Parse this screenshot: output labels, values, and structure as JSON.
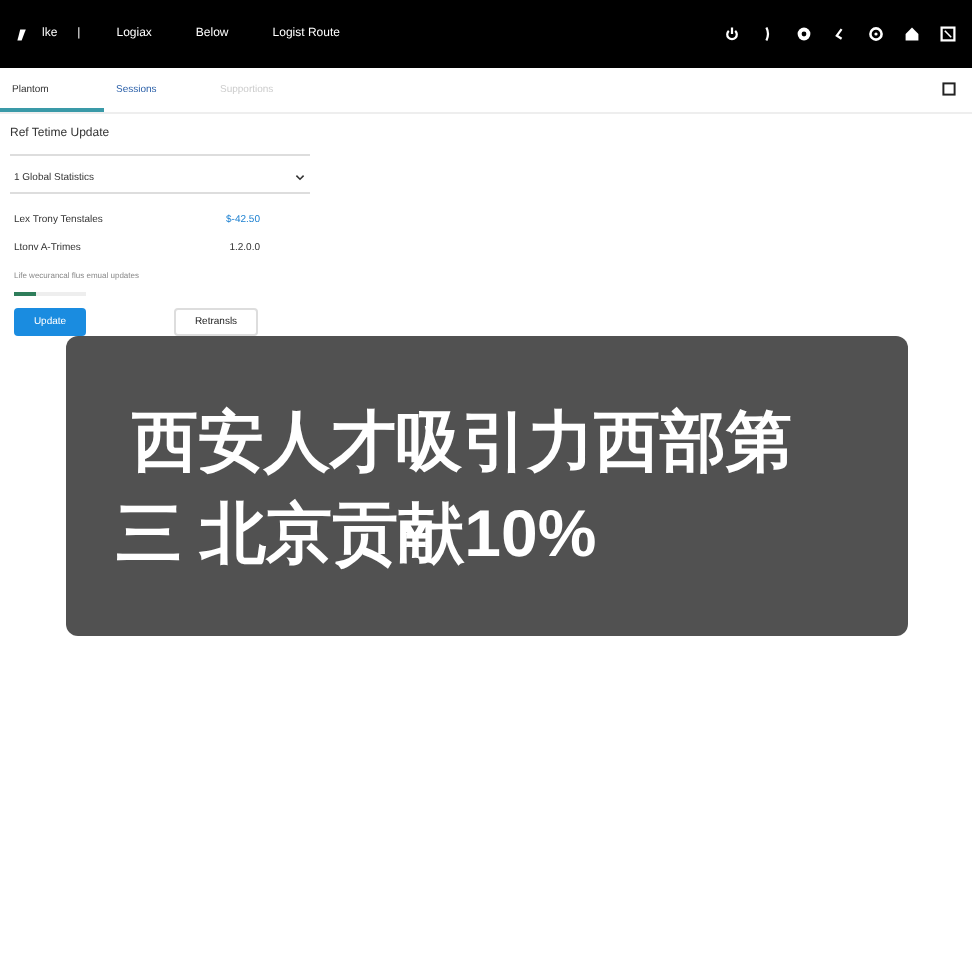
{
  "topbar": {
    "brand": "lke",
    "separator": "|",
    "nav": [
      {
        "label": "Logiax"
      },
      {
        "label": "Below"
      },
      {
        "label": "Logist Route"
      }
    ]
  },
  "tabs": [
    {
      "label": "Plantom",
      "selected": true,
      "disabled": false
    },
    {
      "label": "Sessions",
      "selected": false,
      "disabled": false
    },
    {
      "label": "Supportions",
      "selected": false,
      "disabled": true
    }
  ],
  "panel": {
    "title": "Ref Tetime Update",
    "dropdown": "1 Global Statistics",
    "rows": [
      {
        "label": "Lex Trony Tenstales",
        "value": "$-42.50",
        "highlight": true
      },
      {
        "label": "Ltonv A-Trimes",
        "value": "1.2.0.0",
        "highlight": false
      }
    ],
    "note": "Life wecurancal flus emual updates",
    "progress": {
      "level": 0.3
    },
    "buttons": [
      {
        "label": "Update",
        "primary": true
      },
      {
        "label": "Retransls",
        "primary": false
      }
    ]
  },
  "caption": [
    "西安人才吸引力西部第",
    "三 北京贡献10%"
  ]
}
